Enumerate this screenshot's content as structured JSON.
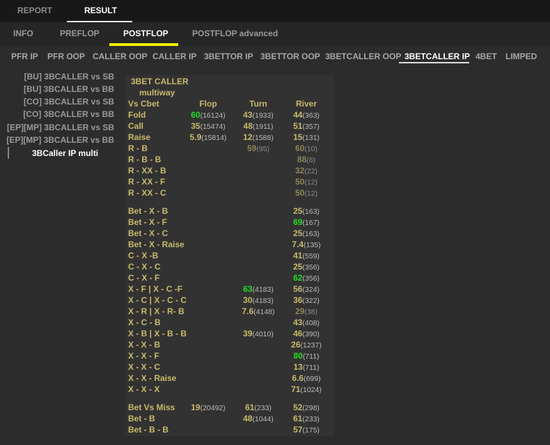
{
  "top_tabs": [
    {
      "label": "REPORT"
    },
    {
      "label": "RESULT"
    }
  ],
  "sub_tabs": [
    {
      "label": "INFO"
    },
    {
      "label": "PREFLOP"
    },
    {
      "label": "POSTFLOP"
    },
    {
      "label": "POSTFLOP advanced"
    }
  ],
  "position_tabs": [
    {
      "label": "PFR IP"
    },
    {
      "label": "PFR OOP"
    },
    {
      "label": "CALLER OOP"
    },
    {
      "label": "CALLER IP"
    },
    {
      "label": "3BETTOR IP"
    },
    {
      "label": "3BETTOR OOP"
    },
    {
      "label": "3BETCALLER OOP"
    },
    {
      "label": "3BETCALLER IP"
    },
    {
      "label": "4BET"
    },
    {
      "label": "LIMPED"
    }
  ],
  "sidebar": [
    {
      "label": "[BU] 3BCALLER vs SB"
    },
    {
      "label": "[BU] 3BCALLER vs BB"
    },
    {
      "label": "[CO] 3BCALLER vs SB"
    },
    {
      "label": "[CO] 3BCALLER vs BB"
    },
    {
      "label": "[EP][MP] 3BCALLER vs SB"
    },
    {
      "label": "[EP][MP] 3BCALLER vs BB"
    },
    {
      "label": "3BCaller IP multi"
    }
  ],
  "table": {
    "title": "3BET CALLER",
    "subtitle": "multiway",
    "headers": {
      "label": "Vs Cbet",
      "flop": "Flop",
      "turn": "Turn",
      "river": "River"
    },
    "rows": [
      {
        "label": "Fold",
        "flop": {
          "v": "60",
          "n": "(16124)",
          "s": "g"
        },
        "turn": {
          "v": "43",
          "n": "(1933)",
          "s": "y"
        },
        "river": {
          "v": "44",
          "n": "(363)",
          "s": "y"
        }
      },
      {
        "label": "Call",
        "flop": {
          "v": "35",
          "n": "(15474)",
          "s": "y"
        },
        "turn": {
          "v": "48",
          "n": "(1911)",
          "s": "y"
        },
        "river": {
          "v": "51",
          "n": "(357)",
          "s": "y"
        }
      },
      {
        "label": "Raise",
        "flop": {
          "v": "5.9",
          "n": "(15814)",
          "s": "y"
        },
        "turn": {
          "v": "12",
          "n": "(1588)",
          "s": "y"
        },
        "river": {
          "v": "15",
          "n": "(131)",
          "s": "y"
        }
      },
      {
        "label": "R - B",
        "turn": {
          "v": "59",
          "n": "(95)",
          "s": "d"
        },
        "river": {
          "v": "60",
          "n": "(10)",
          "s": "d"
        }
      },
      {
        "label": "R - B - B",
        "river": {
          "v": "88",
          "n": "(8)",
          "s": "d"
        }
      },
      {
        "label": "R - XX - B",
        "river": {
          "v": "32",
          "n": "(22)",
          "s": "d"
        }
      },
      {
        "label": "R - XX - F",
        "river": {
          "v": "50",
          "n": "(12)",
          "s": "d"
        }
      },
      {
        "label": "R - XX - C",
        "river": {
          "v": "50",
          "n": "(12)",
          "s": "d"
        }
      },
      {
        "gap": true
      },
      {
        "label": "Bet - X - B",
        "river": {
          "v": "25",
          "n": "(163)",
          "s": "y"
        }
      },
      {
        "label": "Bet - X - F",
        "river": {
          "v": "69",
          "n": "(167)",
          "s": "g"
        }
      },
      {
        "label": "Bet - X - C",
        "river": {
          "v": "25",
          "n": "(163)",
          "s": "y"
        }
      },
      {
        "label": "Bet - X - Raise",
        "river": {
          "v": "7.4",
          "n": "(135)",
          "s": "y"
        }
      },
      {
        "label": "C - X -B",
        "river": {
          "v": "41",
          "n": "(559)",
          "s": "y"
        }
      },
      {
        "label": "C - X - C",
        "river": {
          "v": "25",
          "n": "(356)",
          "s": "y"
        }
      },
      {
        "label": "C - X - F",
        "river": {
          "v": "62",
          "n": "(356)",
          "s": "g"
        }
      },
      {
        "label": "X - F  |  X - C -F",
        "turn": {
          "v": "63",
          "n": "(4183)",
          "s": "g"
        },
        "river": {
          "v": "56",
          "n": "(324)",
          "s": "y"
        }
      },
      {
        "label": "X - C | X - C - C",
        "turn": {
          "v": "30",
          "n": "(4183)",
          "s": "y"
        },
        "river": {
          "v": "36",
          "n": "(322)",
          "s": "y"
        }
      },
      {
        "label": "X - R | X - R- B",
        "turn": {
          "v": "7.6",
          "n": "(4148)",
          "s": "y"
        },
        "river": {
          "v": "29",
          "n": "(38)",
          "s": "d"
        }
      },
      {
        "label": "X - C - B",
        "river": {
          "v": "43",
          "n": "(408)",
          "s": "y"
        }
      },
      {
        "label": "X - B | X - B - B",
        "turn": {
          "v": "39",
          "n": "(4010)",
          "s": "y"
        },
        "river": {
          "v": "46",
          "n": "(390)",
          "s": "y"
        }
      },
      {
        "label": "X - X - B",
        "river": {
          "v": "26",
          "n": "(1237)",
          "s": "y"
        }
      },
      {
        "label": "X - X - F",
        "river": {
          "v": "80",
          "n": "(711)",
          "s": "g"
        }
      },
      {
        "label": "X - X - C",
        "river": {
          "v": "13",
          "n": "(711)",
          "s": "y"
        }
      },
      {
        "label": "X - X - Raise",
        "river": {
          "v": "6.6",
          "n": "(699)",
          "s": "y"
        }
      },
      {
        "label": "X - X - X",
        "river": {
          "v": "71",
          "n": "(1024)",
          "s": "y"
        }
      },
      {
        "gap": true
      },
      {
        "label": "Bet Vs Miss",
        "flop": {
          "v": "19",
          "n": "(20492)",
          "s": "y"
        },
        "turn": {
          "v": "61",
          "n": "(233)",
          "s": "y"
        },
        "river": {
          "v": "52",
          "n": "(298)",
          "s": "y"
        }
      },
      {
        "label": "Bet - B",
        "turn": {
          "v": "48",
          "n": "(1044)",
          "s": "y"
        },
        "river": {
          "v": "61",
          "n": "(233)",
          "s": "y"
        }
      },
      {
        "label": "Bet - B - B",
        "river": {
          "v": "57",
          "n": "(175)",
          "s": "y"
        }
      }
    ]
  },
  "colors": {
    "accent": "#f0f000",
    "label": "#c7bb6c",
    "highlight": "#22e022"
  }
}
